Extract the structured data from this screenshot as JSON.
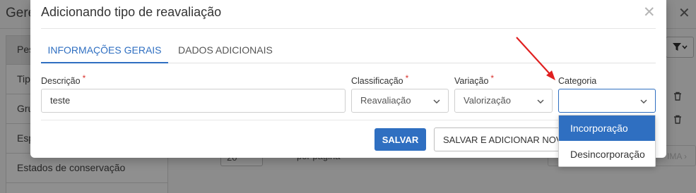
{
  "background": {
    "title": "Gere",
    "close_glyph": "✕",
    "sidebar_items": [
      {
        "label": "Pes"
      },
      {
        "label": "Tip"
      },
      {
        "label": "Gru"
      },
      {
        "label": "Esp"
      },
      {
        "label": "Estados de conservação"
      }
    ],
    "filter_icon": "filter-icon",
    "input_value": "20",
    "partial_text": "por página",
    "pager_label": "IMA ›"
  },
  "modal": {
    "title": "Adicionando tipo de reavaliação",
    "close_glyph": "✕",
    "tabs": [
      {
        "label": "INFORMAÇÕES GERAIS",
        "active": true
      },
      {
        "label": "DADOS ADICIONAIS",
        "active": false
      }
    ],
    "fields": {
      "descricao": {
        "label": "Descrição",
        "required": "*",
        "value": "teste"
      },
      "classificacao": {
        "label": "Classificação",
        "required": "*",
        "value": "Reavaliação"
      },
      "variacao": {
        "label": "Variação",
        "required": "*",
        "value": "Valorização"
      },
      "categoria": {
        "label": "Categoria",
        "value": ""
      }
    },
    "buttons": {
      "save": "SALVAR",
      "save_and_add": "SALVAR E ADICIONAR NOVO"
    },
    "dropdown_options": [
      {
        "label": "Incorporação",
        "highlighted": true
      },
      {
        "label": "Desincorporação",
        "highlighted": false
      }
    ]
  },
  "colors": {
    "accent": "#2f6fc1",
    "required": "#d9322d",
    "annotation_arrow": "#e02020"
  }
}
